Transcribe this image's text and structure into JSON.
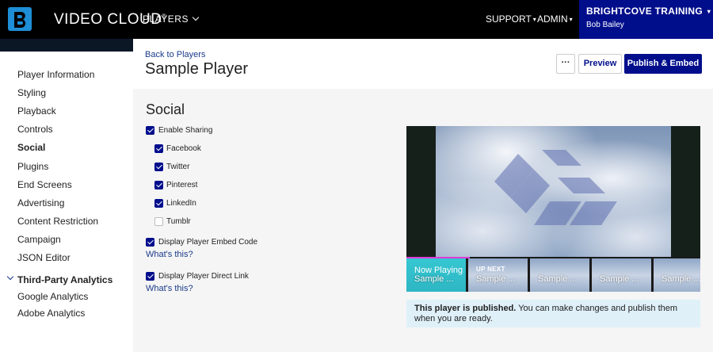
{
  "topbar": {
    "brand": "VIDEO CLOUD",
    "brand_mark": "®",
    "players_label": "PLAYERS",
    "support_label": "SUPPORT",
    "admin_label": "ADMIN",
    "account_name": "BRIGHTCOVE TRAINING",
    "account_user": "Bob Bailey",
    "caret": "▾"
  },
  "sidebar": {
    "items": [
      {
        "label": "Player Information"
      },
      {
        "label": "Styling"
      },
      {
        "label": "Playback"
      },
      {
        "label": "Controls"
      },
      {
        "label": "Social"
      },
      {
        "label": "Plugins"
      },
      {
        "label": "End Screens"
      },
      {
        "label": "Advertising"
      },
      {
        "label": "Content Restriction"
      },
      {
        "label": "Campaign"
      },
      {
        "label": "JSON Editor"
      }
    ],
    "active": "Social",
    "group_label": "Third-Party Analytics",
    "group_items": [
      {
        "label": "Google Analytics"
      },
      {
        "label": "Adobe Analytics"
      }
    ]
  },
  "header": {
    "back_link": "Back to Players",
    "title": "Sample Player",
    "more_label": "···",
    "preview_label": "Preview",
    "publish_label": "Publish & Embed"
  },
  "social": {
    "title": "Social",
    "enable_sharing": {
      "label": "Enable Sharing",
      "checked": true
    },
    "networks": [
      {
        "label": "Facebook",
        "checked": true
      },
      {
        "label": "Twitter",
        "checked": true
      },
      {
        "label": "Pinterest",
        "checked": true
      },
      {
        "label": "LinkedIn",
        "checked": true
      },
      {
        "label": "Tumblr",
        "checked": false
      }
    ],
    "embed_code": {
      "label": "Display Player Embed Code",
      "checked": true
    },
    "direct_link": {
      "label": "Display Player Direct Link",
      "checked": true
    },
    "whats_this": "What's this?"
  },
  "playlist": {
    "now_playing": "Now Playing",
    "up_next": "UP NEXT",
    "items": [
      {
        "title": "Sample ..."
      },
      {
        "title": "Sample ..."
      },
      {
        "title": "Sample ..."
      },
      {
        "title": "Sample ..."
      },
      {
        "title": "Sample ..."
      }
    ]
  },
  "notice": {
    "bold": "This player is published.",
    "text": " You can make changes and publish them when you are ready."
  },
  "colors": {
    "brand_blue": "#000e8c",
    "link": "#1a3a8a",
    "now_playing": "#35c7d2",
    "progress": "#e03ad8",
    "notice_bg": "#dff0f9"
  }
}
